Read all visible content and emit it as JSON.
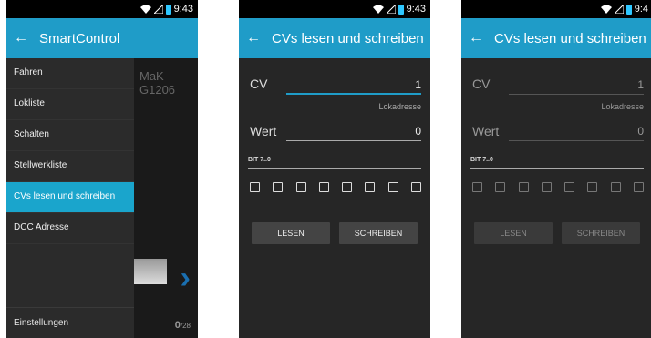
{
  "status": {
    "time_left": "9:43",
    "time_mid": "9:43",
    "time_right": "9:4"
  },
  "drawer_screen": {
    "app_title": "SmartControl",
    "loco_name": "MaK G1206",
    "items": [
      "Fahren",
      "Lokliste",
      "Schalten",
      "Stellwerkliste",
      "CVs lesen und schreiben",
      "DCC Adresse"
    ],
    "active_index": 4,
    "settings_label": "Einstellungen",
    "counter": "0",
    "counter_total": "/28"
  },
  "cv_screen": {
    "title": "CVs lesen und schreiben",
    "cv_label": "CV",
    "cv_value": "1",
    "cv_hint": "Lokadresse",
    "wert_label": "Wert",
    "wert_value": "0",
    "bit_label": "BIT 7..0",
    "read_button": "LESEN",
    "write_button": "SCHREIBEN"
  },
  "cv_screen_disabled": {
    "title": "CVs lesen und schreiben",
    "cv_label": "CV",
    "cv_value": "1",
    "cv_hint": "Lokadresse",
    "wert_label": "Wert",
    "wert_value": "0",
    "bit_label": "BIT 7..0",
    "read_button": "LESEN",
    "write_button": "SCHREIBEN"
  }
}
